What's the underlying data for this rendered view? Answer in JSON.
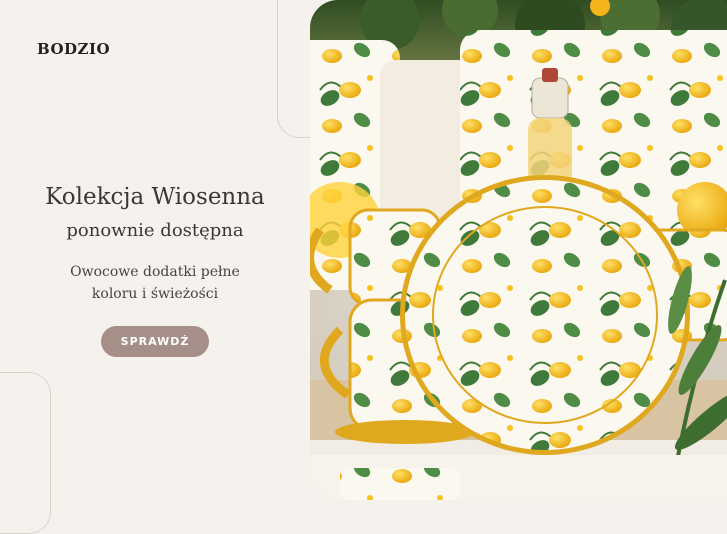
{
  "brand": {
    "logo": "BODZIO"
  },
  "hero": {
    "headline": "Kolekcja Wiosenna",
    "subheadline": "ponownie dostępna",
    "description_line1": "Owocowe dodatki pełne",
    "description_line2": "koloru i świeżości",
    "cta_label": "SPRAWDŹ"
  },
  "colors": {
    "background": "#f5f2ee",
    "cta_bg": "#a78f89",
    "lemon": "#f6c21b",
    "leaf": "#3f7a3a"
  },
  "image": {
    "subject": "lemon-pattern-tableware-photo"
  }
}
